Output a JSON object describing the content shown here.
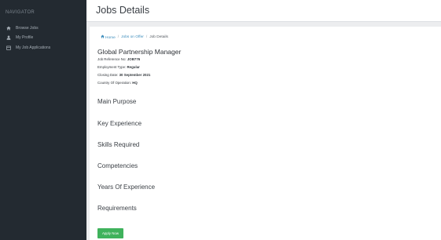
{
  "sidebar": {
    "title": "NAVIGATOR",
    "items": [
      {
        "label": "Browse Jobs",
        "icon": "home-icon"
      },
      {
        "label": "My Profile",
        "icon": "user-icon"
      },
      {
        "label": "My Job Applications",
        "icon": "calendar-icon"
      }
    ]
  },
  "header": {
    "title": "Jobs Details"
  },
  "breadcrumb": {
    "home": "Home",
    "separator": "/",
    "jobs_on_offer": "Jobs on Offer",
    "current": "Job Details"
  },
  "job": {
    "title": "Global Partnership Manager",
    "reference_label": "Job Reference No:",
    "reference_value": "JOB776",
    "employment_label": "Employment Type:",
    "employment_value": "Regular",
    "closing_label": "Closing Date:",
    "closing_value": "30 September 2021",
    "country_label": "Country Of Operation:",
    "country_value": "HQ"
  },
  "sections": {
    "main_purpose": "Main Purpose",
    "key_experience": "Key Experience",
    "skills_required": "Skills Required",
    "competencies": "Competencies",
    "years_of_experience": "Years Of Experience",
    "requirements": "Requirements"
  },
  "apply_button": "Apply Now",
  "colors": {
    "sidebar_bg": "#232a31",
    "link": "#3c8dbc",
    "apply_button": "#3fb25c"
  }
}
